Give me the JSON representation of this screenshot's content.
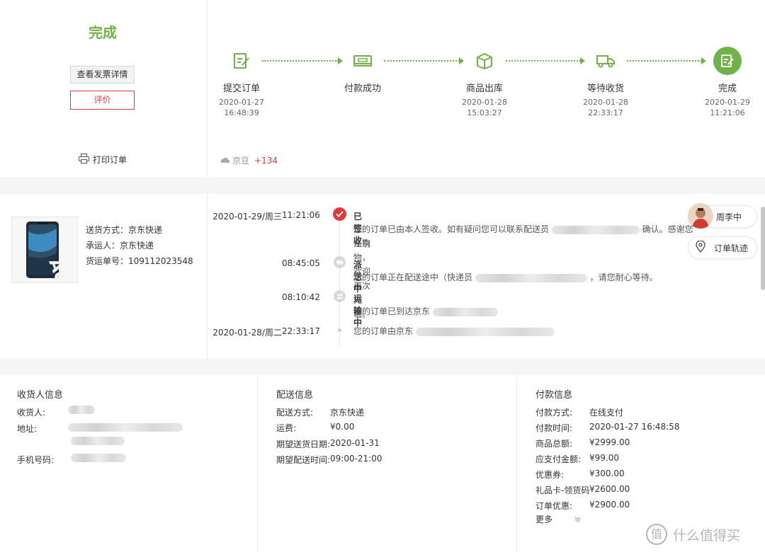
{
  "order_status": {
    "title": "完成",
    "invoice_button": "查看发票详情",
    "review_button": "评价",
    "print_label": "打印订单"
  },
  "progress": {
    "steps": [
      {
        "label": "提交订单",
        "date": "2020-01-27",
        "time": "16:48:39",
        "icon": "edit-icon"
      },
      {
        "label": "付款成功",
        "date": "",
        "time": "",
        "icon": "payment-icon"
      },
      {
        "label": "商品出库",
        "date": "2020-01-28",
        "time": "15:03:27",
        "icon": "package-icon"
      },
      {
        "label": "等待收货",
        "date": "2020-01-28",
        "time": "22:33:17",
        "icon": "truck-icon"
      },
      {
        "label": "完成",
        "date": "2020-01-29",
        "time": "11:21:06",
        "icon": "check-edit-icon"
      }
    ],
    "jd_bean": {
      "label": "京豆",
      "value": "+134"
    }
  },
  "shipment": {
    "method_label": "送货方式：",
    "method_value": "京东快递",
    "carrier_label": "承运人：",
    "carrier_value": "京东快递",
    "tracking_label": "货运单号：",
    "tracking_value": "109112023548"
  },
  "tracking": [
    {
      "date": "2020-01-29/周三",
      "time": "11:21:06",
      "title": "已签收",
      "text_1": "您的订单已由本人签收。如有疑问您可以联系配送员",
      "text_2": "确认。感谢您在京",
      "text_3": "东购物，欢迎再次光临。"
    },
    {
      "date": "",
      "time": "08:45:05",
      "title": "派送中",
      "text_1": "您的订单正在配送途中（快递员",
      "text_2": "，请您耐心等待。"
    },
    {
      "date": "",
      "time": "08:10:42",
      "title": "运输中",
      "text_1": "您的订单已到达京东"
    },
    {
      "date": "2020-01-28/周二",
      "time": "22:33:17",
      "title": "",
      "text_1": "您的订单由京东"
    }
  ],
  "side_widgets": {
    "courier_name": "周李中",
    "track_label": "订单轨迹"
  },
  "receiver": {
    "heading": "收货人信息",
    "name_label": "收货人:",
    "address_label": "地址:",
    "phone_label": "手机号码:"
  },
  "delivery": {
    "heading": "配送信息",
    "rows": [
      {
        "k": "配送方式:",
        "v": "京东快递"
      },
      {
        "k": "运费:",
        "v": "¥0.00"
      },
      {
        "k": "期望送货日期:",
        "v": "2020-01-31"
      },
      {
        "k": "期望配送时间:",
        "v": "09:00-21:00"
      }
    ]
  },
  "payment": {
    "heading": "付款信息",
    "rows": [
      {
        "k": "付款方式:",
        "v": "在线支付"
      },
      {
        "k": "付款时间:",
        "v": "2020-01-27 16:48:58"
      },
      {
        "k": "商品总额:",
        "v": "¥2999.00"
      },
      {
        "k": "应支付金额:",
        "v": "¥99.00"
      },
      {
        "k": "优惠券:",
        "v": "¥300.00"
      },
      {
        "k": "礼品卡-领货码",
        "v": "¥2600.00"
      },
      {
        "k": "订单优惠:",
        "v": "¥2900.00"
      }
    ],
    "more_label": "更多"
  },
  "watermark": "值 什么值得买",
  "colors": {
    "green": "#71b247",
    "red": "#e4393c"
  }
}
